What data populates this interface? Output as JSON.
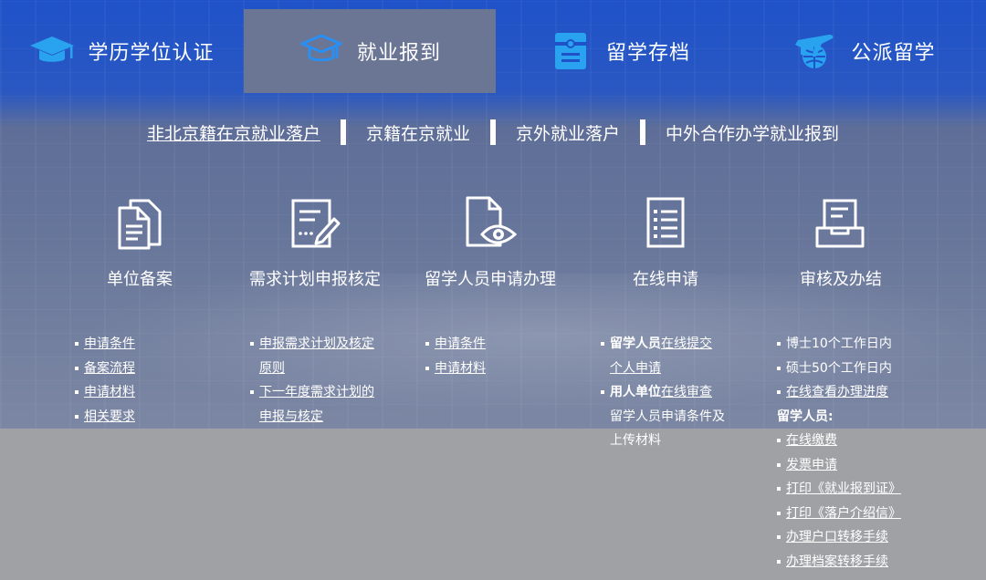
{
  "tabs": [
    {
      "label": "学历学位认证",
      "icon": "graduation-cap-icon",
      "active": false
    },
    {
      "label": "就业报到",
      "icon": "graduation-cap-icon",
      "active": true
    },
    {
      "label": "留学存档",
      "icon": "archive-document-icon",
      "active": false
    },
    {
      "label": "公派留学",
      "icon": "airplane-globe-icon",
      "active": false
    }
  ],
  "subnav": [
    "非北京籍在京就业落户",
    "京籍在京就业",
    "京外就业落户",
    "中外合作办学就业报到"
  ],
  "steps": [
    {
      "title": "单位备案",
      "icon": "documents-icon"
    },
    {
      "title": "需求计划申报核定",
      "icon": "edit-form-icon"
    },
    {
      "title": "留学人员申请办理",
      "icon": "document-eye-icon"
    },
    {
      "title": "在线申请",
      "icon": "checklist-icon"
    },
    {
      "title": "审核及办结",
      "icon": "inbox-tray-icon"
    }
  ],
  "columns": {
    "c1": [
      "申请条件",
      "备案流程",
      "申请材料",
      "相关要求"
    ],
    "c2": [
      "申报需求计划及核定",
      "原则",
      "下一年度需求计划的",
      "申报与核定"
    ],
    "c3": [
      "申请条件",
      "申请材料"
    ],
    "c4": {
      "bold1": "留学人员",
      "text1": "在线提交",
      "text1b": "个人申请",
      "bold2": "用人单位",
      "text2": "在线审查",
      "text2b": "留学人员申请条件及",
      "text2c": "上传材料"
    },
    "c5": {
      "plain": [
        "博士10个工作日内",
        "硕士50个工作日内"
      ],
      "link_progress": "在线查看办理进度",
      "subheading": "留学人员:",
      "links": [
        "在线缴费",
        "发票申请",
        "打印《就业报到证》",
        "打印《落户介绍信》",
        "办理户口转移手续",
        "办理档案转移手续"
      ]
    }
  },
  "colors": {
    "header_blue": "#1f52c9",
    "active_tab": "#6b7594",
    "bottom_gray": "#9fa1a4",
    "icon_blue": "#29a3ef"
  }
}
